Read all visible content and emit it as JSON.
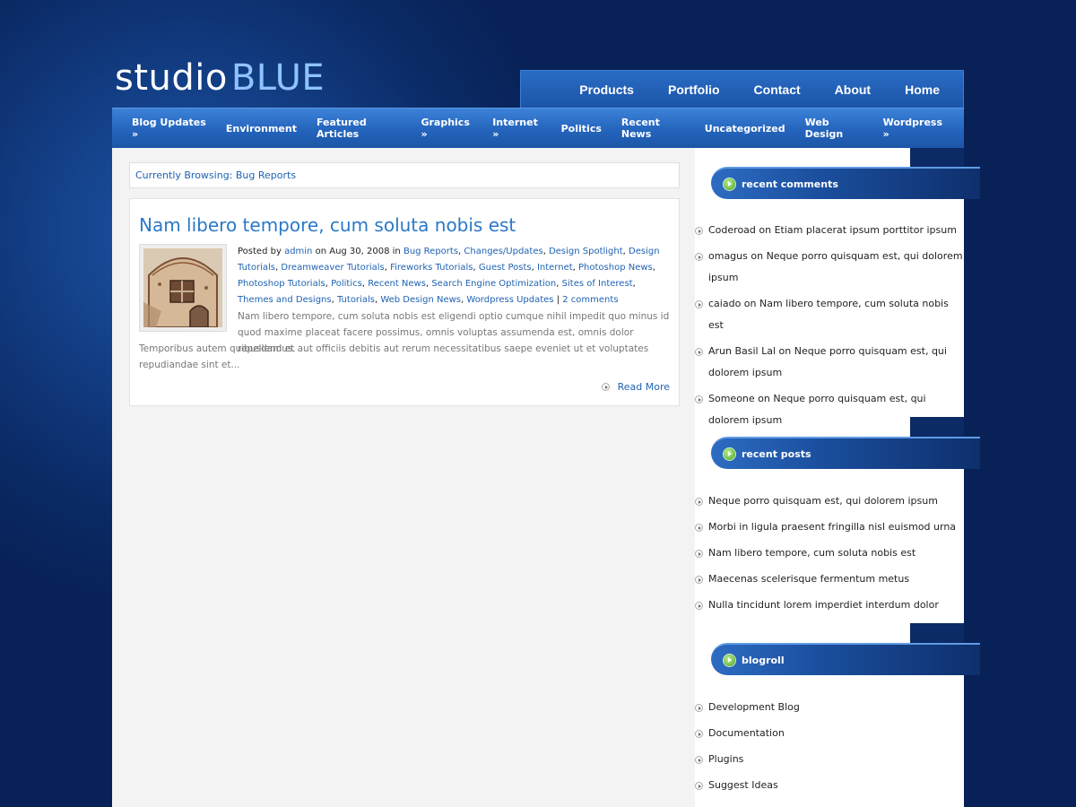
{
  "logo": {
    "part1": "studio",
    "part2": "BLUE"
  },
  "top_nav": [
    "Products",
    "Portfolio",
    "Contact",
    "About",
    "Home"
  ],
  "category_nav": [
    "Blog Updates »",
    "Environment",
    "Featured Articles",
    "Graphics »",
    "Internet »",
    "Politics",
    "Recent News",
    "Uncategorized",
    "Web Design",
    "Wordpress »"
  ],
  "browsing": "Currently Browsing: Bug Reports",
  "post": {
    "title": "Nam libero tempore, cum soluta nobis est",
    "posted_by": "Posted by",
    "author": "admin",
    "on_date": "on Aug 30, 2008 in",
    "categories": [
      "Bug Reports",
      "Changes/Updates",
      "Design Spotlight",
      "Design Tutorials",
      "Dreamweaver Tutorials",
      "Fireworks Tutorials",
      "Guest Posts",
      "Internet",
      "Photoshop News",
      "Photoshop Tutorials",
      "Politics",
      "Recent News",
      "Search Engine Optimization",
      "Sites of Interest",
      "Themes and Designs",
      "Tutorials",
      "Web Design News",
      "Wordpress Updates"
    ],
    "separator": "|",
    "comments": "2 comments",
    "excerpt_line1": "Nam libero tempore, cum soluta nobis est eligendi optio cumque nihil impedit quo minus id quod maxime placeat facere possimus, omnis voluptas assumenda est, omnis dolor repellendus.",
    "excerpt_line2": "Temporibus autem quibusdam et aut officiis debitis aut rerum necessitatibus saepe eveniet ut et voluptates repudiandae sint et...",
    "read_more": "Read More"
  },
  "sidebar": {
    "recent_comments": {
      "title": "recent comments",
      "items": [
        "Coderoad on Etiam placerat ipsum porttitor ipsum",
        "omagus on Neque porro quisquam est, qui dolorem ipsum",
        "caiado on Nam libero tempore, cum soluta nobis est",
        "Arun Basil Lal on Neque porro quisquam est, qui dolorem ipsum",
        "Someone on Neque porro quisquam est, qui dolorem ipsum"
      ]
    },
    "recent_posts": {
      "title": "recent posts",
      "items": [
        "Neque porro quisquam est, qui dolorem ipsum",
        "Morbi in ligula praesent fringilla nisl euismod urna",
        "Nam libero tempore, cum soluta nobis est",
        "Maecenas scelerisque fermentum metus",
        "Nulla tincidunt lorem imperdiet interdum dolor"
      ]
    },
    "blogroll": {
      "title": "blogroll",
      "items": [
        "Development Blog",
        "Documentation",
        "Plugins",
        "Suggest Ideas"
      ]
    }
  },
  "colors": {
    "page_bg": "#0b2a66",
    "nav_blue": "#2464bc",
    "link": "#2063b3",
    "title": "#2a78c9",
    "logo_accent": "#8ec3ff"
  }
}
